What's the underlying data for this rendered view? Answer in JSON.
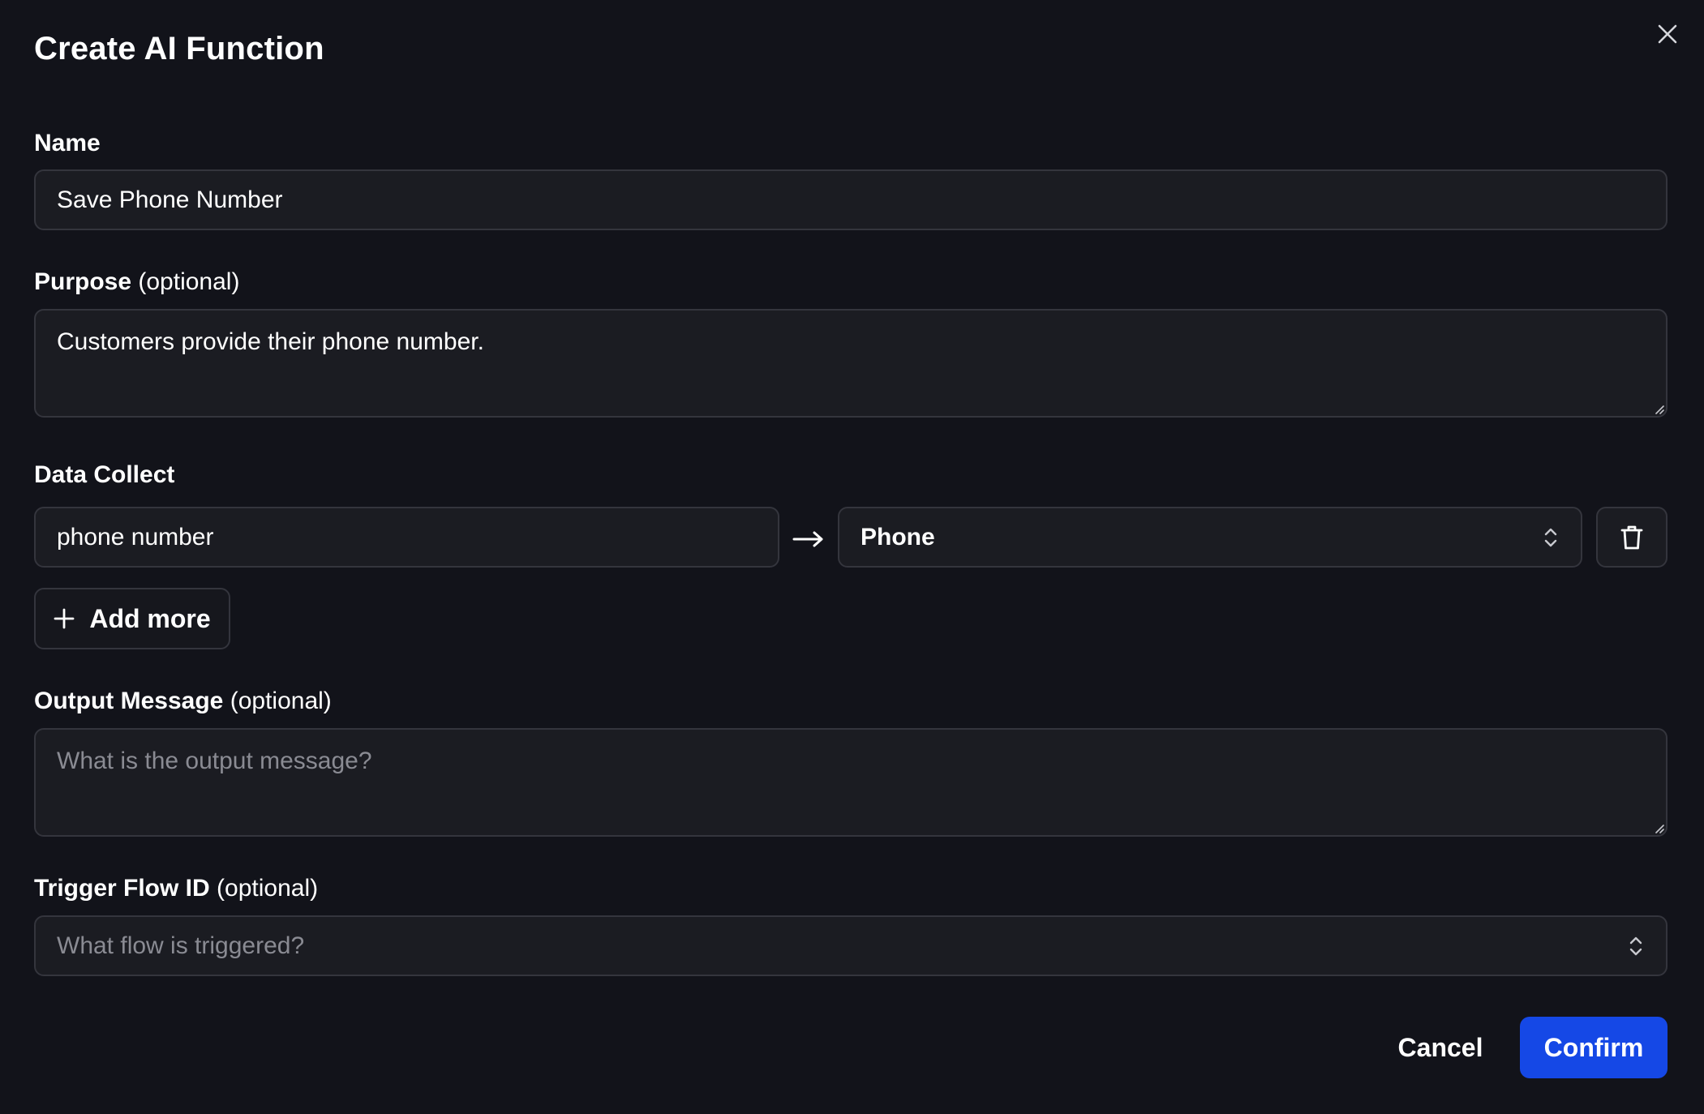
{
  "dialog": {
    "title": "Create AI Function",
    "close_icon": "close-icon"
  },
  "name_field": {
    "label": "Name",
    "value": "Save Phone Number"
  },
  "purpose_field": {
    "label": "Purpose",
    "optional_suffix": "(optional)",
    "value": "Customers provide their phone number."
  },
  "data_collect": {
    "label": "Data Collect",
    "rows": [
      {
        "source_value": "phone number",
        "arrow_icon": "arrow-right-icon",
        "target_value": "Phone",
        "delete_icon": "trash-icon"
      }
    ],
    "add_more_label": "Add more",
    "add_icon": "plus-icon"
  },
  "output_message_field": {
    "label": "Output Message",
    "optional_suffix": "(optional)",
    "value": "",
    "placeholder": "What is the output message?"
  },
  "trigger_flow_field": {
    "label": "Trigger Flow ID",
    "optional_suffix": "(optional)",
    "placeholder": "What flow is triggered?"
  },
  "footer": {
    "cancel_label": "Cancel",
    "confirm_label": "Confirm"
  },
  "colors": {
    "background": "#12131a",
    "field_background": "#1b1c22",
    "field_border": "#34353d",
    "placeholder": "#8a8b93",
    "primary": "#1548e6"
  }
}
